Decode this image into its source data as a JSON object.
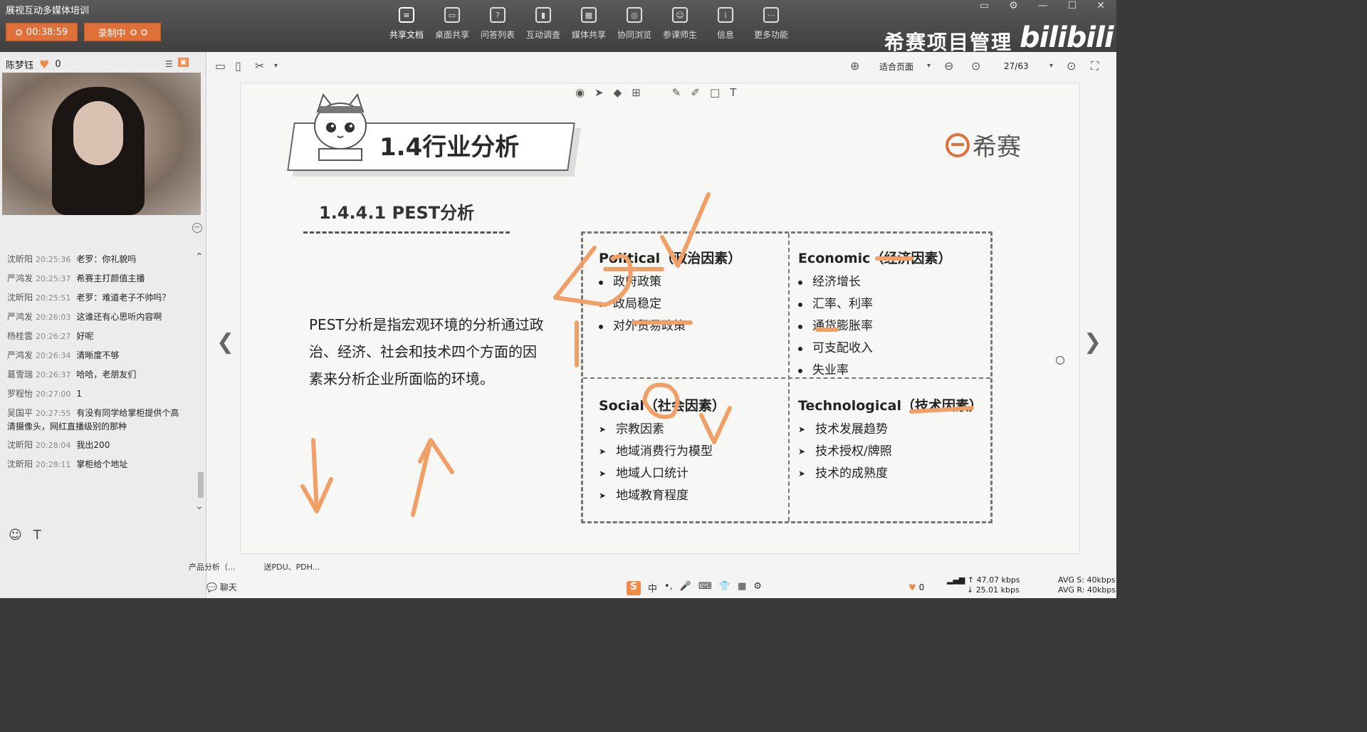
{
  "window": {
    "title": "展视互动多媒体培训"
  },
  "controls": {
    "timer": "00:38:59",
    "record": "录制中"
  },
  "toolbar": [
    {
      "label": "共享文档",
      "icon": "document-icon"
    },
    {
      "label": "桌面共享",
      "icon": "desktop-icon"
    },
    {
      "label": "问答列表",
      "icon": "qa-icon"
    },
    {
      "label": "互动调查",
      "icon": "survey-icon"
    },
    {
      "label": "媒体共享",
      "icon": "media-icon"
    },
    {
      "label": "协同浏览",
      "icon": "browse-icon"
    },
    {
      "label": "参课师生",
      "icon": "people-icon"
    },
    {
      "label": "信息",
      "icon": "info-icon"
    },
    {
      "label": "更多功能",
      "icon": "more-icon"
    }
  ],
  "brand": {
    "name": "希赛项目管理",
    "bili": "bilibili"
  },
  "presenter": {
    "name": "陈梦钰",
    "likes": "0"
  },
  "chat": [
    {
      "who": "沈昕阳",
      "time": "20:25:36",
      "text": "老罗：你礼貌吗"
    },
    {
      "who": "严鸿发",
      "time": "20:25:37",
      "text": "希赛主打颜值主播"
    },
    {
      "who": "沈昕阳",
      "time": "20:25:51",
      "text": "老罗：难道老子不帅吗？"
    },
    {
      "who": "严鸿发",
      "time": "20:26:03",
      "text": "这谁还有心思听内容啊"
    },
    {
      "who": "杨桂雲",
      "time": "20:26:27",
      "text": "好呢"
    },
    {
      "who": "严鸿发",
      "time": "20:26:34",
      "text": "清晰度不够"
    },
    {
      "who": "葛雪瑞",
      "time": "20:26:37",
      "text": "哈哈，老朋友们"
    },
    {
      "who": "罗程怡",
      "time": "20:27:00",
      "text": "1"
    },
    {
      "who": "吴国平",
      "time": "20:27:55",
      "text": "有没有同学给掌柜提供个高清摄像头，网红直播级别的那种"
    },
    {
      "who": "沈昕阳",
      "time": "20:28:04",
      "text": "我出200"
    },
    {
      "who": "沈昕阳",
      "time": "20:28:11",
      "text": "掌柜给个地址"
    }
  ],
  "viewer": {
    "zoom": "适合页面",
    "page": "27/63"
  },
  "slide": {
    "section_title": "1.4行业分析",
    "logo_text": "希赛",
    "sub_title": "1.4.4.1 PEST分析",
    "description": "PEST分析是指宏观环境的分析通过政治、经济、社会和技术四个方面的因素来分析企业所面临的环境。",
    "political": {
      "title": "Political（政治因素）",
      "items": [
        "政府政策",
        "政局稳定",
        "对外贸易政策"
      ]
    },
    "economic": {
      "title": "Economic（经济因素）",
      "items": [
        "经济增长",
        "汇率、利率",
        "通货膨胀率",
        "可支配收入",
        "失业率"
      ]
    },
    "social": {
      "title": "Social（社会因素）",
      "items": [
        "宗教因素",
        "地域消费行为模型",
        "地域人口统计",
        "地域教育程度"
      ]
    },
    "technological": {
      "title": "Technological（技术因素）",
      "items": [
        "技术发展趋势",
        "技术授权/牌照",
        "技术的成熟度"
      ]
    }
  },
  "bottom": {
    "file1": "产品分析（...",
    "file2": "送PDU、PDH...",
    "chat_tab": "聊天",
    "likes": "0"
  },
  "network": {
    "up": "47.07 kbps",
    "down": "25.01 kbps",
    "avg_s": "AVG S: 40kbps",
    "avg_r": "AVG R: 40kbps"
  },
  "colors": {
    "accent": "#e0703a",
    "annotation": "#f0a066"
  }
}
